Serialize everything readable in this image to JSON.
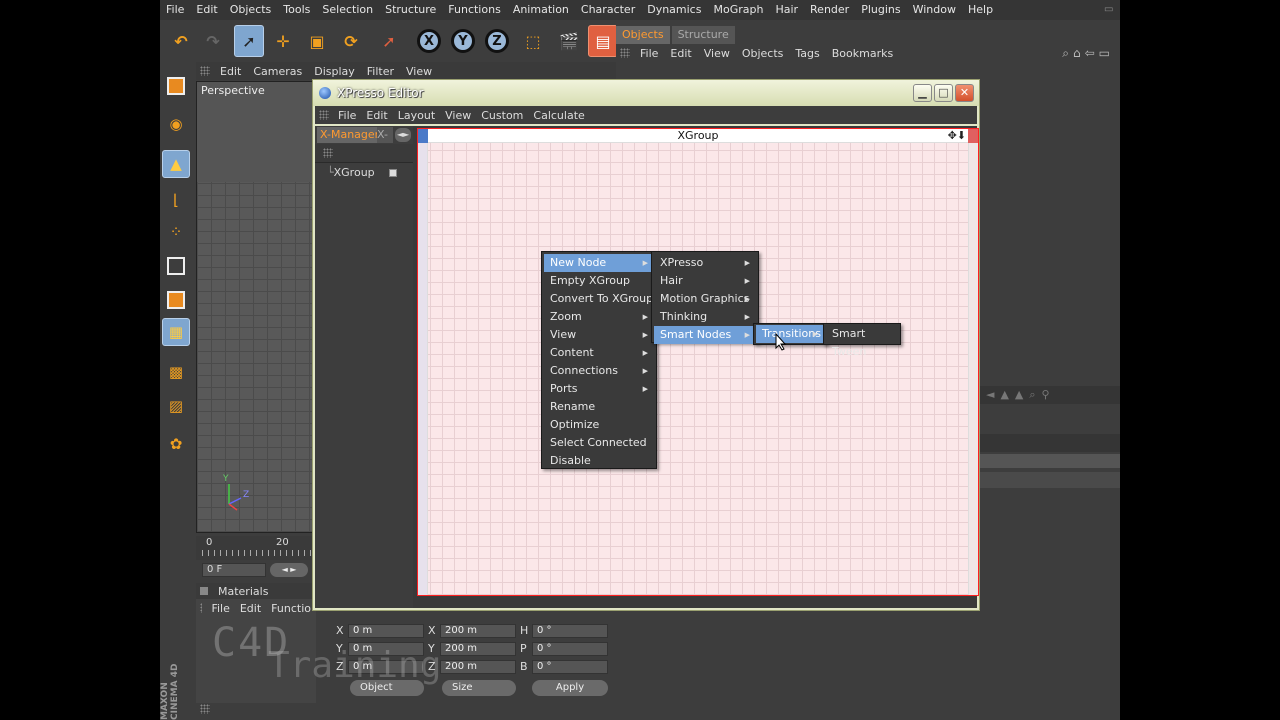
{
  "menubar": [
    "File",
    "Edit",
    "Objects",
    "Tools",
    "Selection",
    "Structure",
    "Functions",
    "Animation",
    "Character",
    "Dynamics",
    "MoGraph",
    "Hair",
    "Render",
    "Plugins",
    "Window",
    "Help"
  ],
  "toolbar": {
    "x_axis": "X",
    "y_axis": "Y",
    "z_axis": "Z"
  },
  "viewport": {
    "menu": [
      "Edit",
      "Cameras",
      "Display",
      "Filter",
      "View"
    ],
    "label": "Perspective",
    "axis_y": "Y",
    "axis_z": "Z"
  },
  "timeline": {
    "start": "0",
    "mark": "20",
    "frame": "0 F",
    "frame_ctl": "◄ ►"
  },
  "materials": {
    "title": "Materials",
    "menu": [
      "File",
      "Edit",
      "Functio"
    ]
  },
  "objects_panel": {
    "tabs": [
      "Objects",
      "Structure"
    ],
    "menu": [
      "File",
      "Edit",
      "View",
      "Objects",
      "Tags",
      "Bookmarks"
    ]
  },
  "coords": {
    "rows": [
      {
        "l1": "X",
        "v1": "0 m",
        "l2": "X",
        "v2": "200 m",
        "l3": "H",
        "v3": "0 °"
      },
      {
        "l1": "Y",
        "v1": "0 m",
        "l2": "Y",
        "v2": "200 m",
        "l3": "P",
        "v3": "0 °"
      },
      {
        "l1": "Z",
        "v1": "0 m",
        "l2": "Z",
        "v2": "200 m",
        "l3": "B",
        "v3": "0 °"
      }
    ],
    "mode": "Object",
    "size": "Size",
    "apply": "Apply"
  },
  "watermark": {
    "line1": "C4D",
    "line2": "Training",
    "brand": "MAXON CINEMA 4D"
  },
  "xpresso": {
    "title": "XPresso Editor",
    "menu": [
      "File",
      "Edit",
      "Layout",
      "View",
      "Custom",
      "Calculate"
    ],
    "manager_tab": "X-Manager",
    "manager_tab2": "X-F",
    "tree_item": "XGroup",
    "canvas_title": "XGroup"
  },
  "context_menu": {
    "items": [
      {
        "label": "New Node",
        "sub": true
      },
      {
        "label": "Empty XGroup",
        "sub": false
      },
      {
        "label": "Convert To XGroup",
        "sub": false
      },
      {
        "label": "Zoom",
        "sub": true
      },
      {
        "label": "View",
        "sub": true
      },
      {
        "label": "Content",
        "sub": true
      },
      {
        "label": "Connections",
        "sub": true
      },
      {
        "label": "Ports",
        "sub": true
      },
      {
        "label": "Rename",
        "sub": false
      },
      {
        "label": "Optimize",
        "sub": false
      },
      {
        "label": "Select Connected",
        "sub": false
      },
      {
        "label": "Disable",
        "sub": false
      }
    ],
    "submenu1": [
      "XPresso",
      "Hair",
      "Motion Graphics",
      "Thinking Particles",
      "Smart Nodes"
    ],
    "submenu2": [
      "Transitions"
    ],
    "submenu3": [
      "Smart Tween"
    ]
  },
  "colors": {
    "highlight": "#6f9fd8",
    "accent_orange": "#ff9a30",
    "canvas_border": "#ff2020"
  }
}
